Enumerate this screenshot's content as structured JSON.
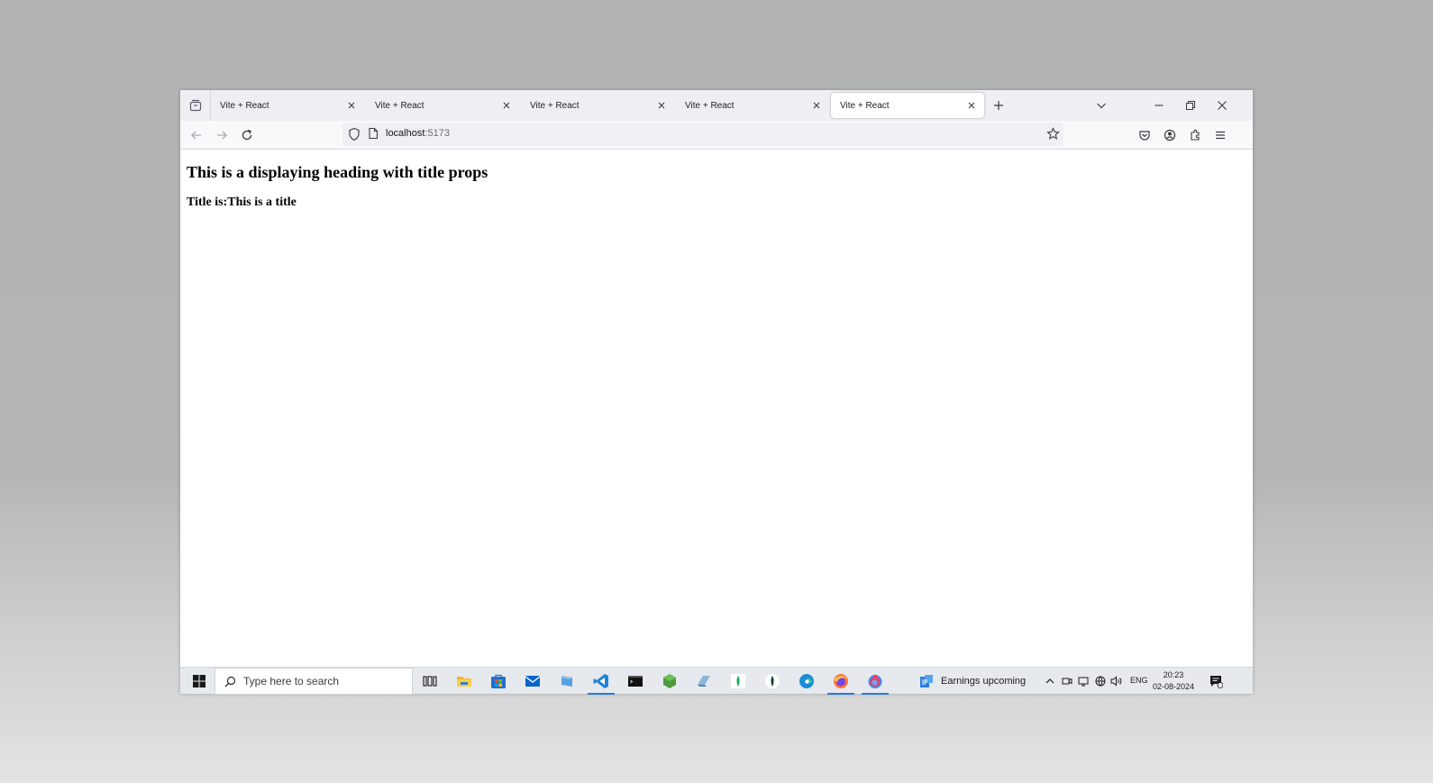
{
  "browser": {
    "tabs": [
      {
        "title": "Vite + React",
        "active": false
      },
      {
        "title": "Vite + React",
        "active": false
      },
      {
        "title": "Vite + React",
        "active": false
      },
      {
        "title": "Vite + React",
        "active": false
      },
      {
        "title": "Vite + React",
        "active": true
      }
    ],
    "url": {
      "host": "localhost",
      "port": ":5173"
    }
  },
  "page": {
    "heading": "This is a displaying heading with title props",
    "subheading": "Title is:This is a title"
  },
  "taskbar": {
    "search_placeholder": "Type here to search",
    "apps": [
      "task-view",
      "file-explorer",
      "microsoft-store",
      "mail",
      "app",
      "vscode",
      "terminal",
      "nodejs",
      "app",
      "mongodb-compass",
      "mongodb",
      "edge",
      "firefox",
      "firefox-developer"
    ],
    "news": "Earnings upcoming",
    "language": "ENG",
    "time": "20:23",
    "date": "02-08-2024"
  },
  "colors": {
    "accent": "#2b79d8",
    "tab_bg": "#efeef2",
    "toolbar_bg": "#f9f9fb"
  }
}
